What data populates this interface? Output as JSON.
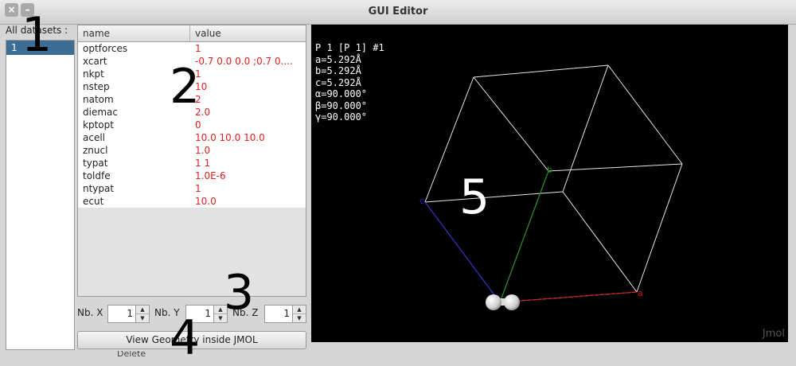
{
  "window": {
    "title": "GUI Editor",
    "close_glyph": "×",
    "minimize_glyph": "–"
  },
  "markers": [
    "1",
    "2",
    "3",
    "4",
    "5"
  ],
  "datasets": {
    "label": "All datasets :",
    "items": [
      "1"
    ]
  },
  "table": {
    "headers": {
      "name": "name",
      "value": "value"
    },
    "rows": [
      {
        "name": "optforces",
        "value": "1"
      },
      {
        "name": "xcart",
        "value": "-0.7 0.0 0.0 ;0.7 0...."
      },
      {
        "name": "nkpt",
        "value": "1"
      },
      {
        "name": "nstep",
        "value": "10"
      },
      {
        "name": "natom",
        "value": "2"
      },
      {
        "name": "diemac",
        "value": "2.0"
      },
      {
        "name": "kptopt",
        "value": "0"
      },
      {
        "name": "acell",
        "value": "10.0 10.0 10.0"
      },
      {
        "name": "znucl",
        "value": "1.0"
      },
      {
        "name": "typat",
        "value": "1 1"
      },
      {
        "name": "toldfe",
        "value": "1.0E-6"
      },
      {
        "name": "ntypat",
        "value": "1"
      },
      {
        "name": "ecut",
        "value": "10.0"
      }
    ]
  },
  "spinners": {
    "x": {
      "label": "Nb. X",
      "value": "1"
    },
    "y": {
      "label": "Nb. Y",
      "value": "1"
    },
    "z": {
      "label": "Nb. Z",
      "value": "1"
    },
    "up_glyph": "▲",
    "down_glyph": "▼"
  },
  "view_button": "View Geometry inside JMOL",
  "below_button": "Delete",
  "viewer": {
    "info_lines": [
      "P 1 [P 1] #1",
      "a=5.292Å",
      "b=5.292Å",
      "c=5.292Å",
      "α=90.000°",
      "β=90.000°",
      "γ=90.000°"
    ],
    "axis_labels": {
      "a": "a",
      "b": "b",
      "c": "c"
    },
    "watermark": "Jmol",
    "colors": {
      "background": "#000000",
      "cell": "#e6e6e6",
      "axis_a": "#d01010",
      "axis_b": "#1a8a1a",
      "axis_c": "#2020c8",
      "atom": "#f0f0f0"
    }
  }
}
